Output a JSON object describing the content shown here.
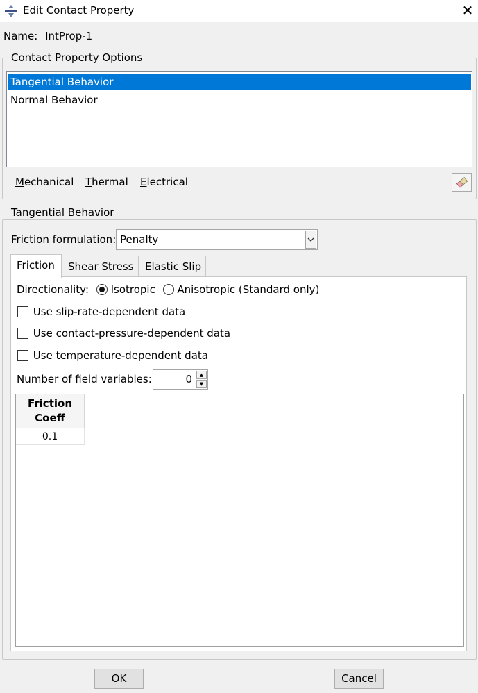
{
  "window": {
    "title": "Edit Contact Property",
    "app_icon": "abaqus-logo-icon",
    "close_icon": "close-icon"
  },
  "name": {
    "label": "Name:",
    "value": "IntProp-1"
  },
  "options_group": {
    "title": "Contact Property Options",
    "items": [
      {
        "label": "Tangential Behavior",
        "selected": true
      },
      {
        "label": "Normal Behavior",
        "selected": false
      }
    ],
    "menus": [
      {
        "mnemonic": "M",
        "rest": "echanical"
      },
      {
        "mnemonic": "T",
        "rest": "hermal"
      },
      {
        "mnemonic": "E",
        "rest": "lectrical"
      }
    ],
    "delete_icon": "eraser-icon"
  },
  "tangential": {
    "group_title": "Tangential Behavior",
    "friction_formulation_label": "Friction formulation:",
    "friction_formulation_value": "Penalty",
    "tabs": [
      {
        "label": "Friction",
        "active": true
      },
      {
        "label": "Shear Stress",
        "active": false
      },
      {
        "label": "Elastic Slip",
        "active": false
      }
    ],
    "directionality_label": "Directionality:",
    "isotropic_label": "Isotropic",
    "anisotropic_label": "Anisotropic (Standard only)",
    "directionality_value": "Isotropic",
    "checkboxes": [
      {
        "label": "Use slip-rate-dependent data",
        "checked": false
      },
      {
        "label": "Use contact-pressure-dependent data",
        "checked": false
      },
      {
        "label": "Use temperature-dependent data",
        "checked": false
      }
    ],
    "field_vars_label": "Number of field variables:",
    "field_vars_value": "0",
    "table": {
      "header_line1": "Friction",
      "header_line2": "Coeff",
      "rows": [
        "0.1"
      ]
    }
  },
  "buttons": {
    "ok": "OK",
    "cancel": "Cancel"
  }
}
